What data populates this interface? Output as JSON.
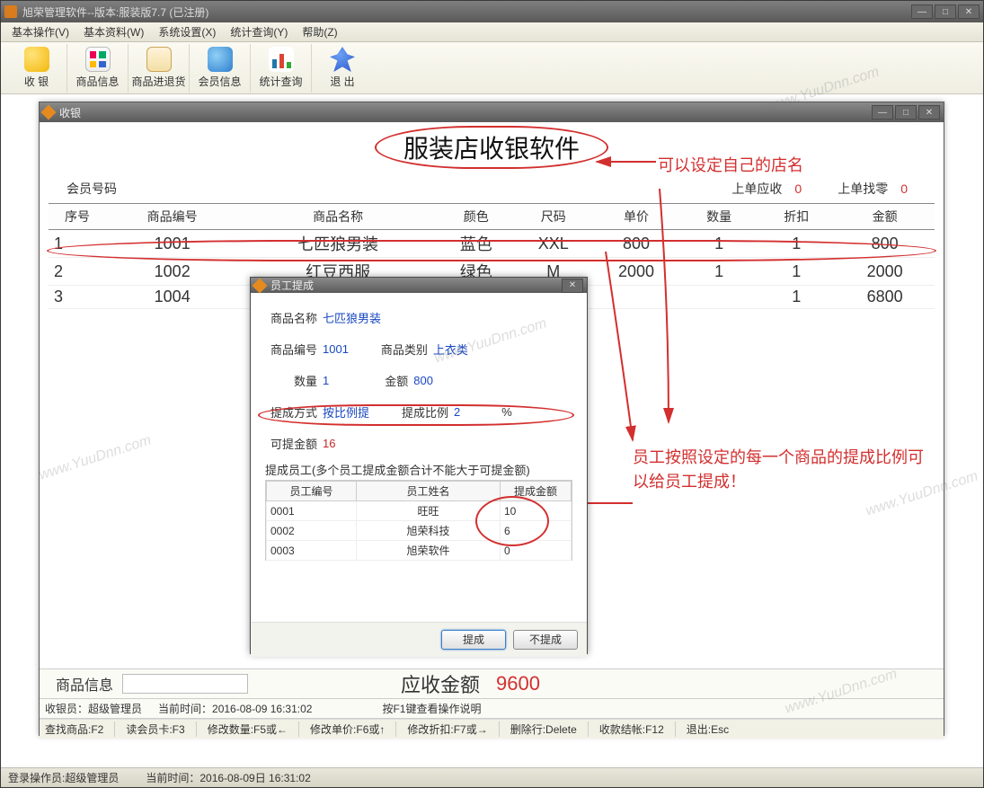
{
  "app": {
    "title": "旭荣管理软件--版本:服装版7.7  (已注册)"
  },
  "menubar": {
    "items": [
      "基本操作(V)",
      "基本资料(W)",
      "系统设置(X)",
      "统计查询(Y)",
      "帮助(Z)"
    ]
  },
  "toolbar": {
    "items": [
      {
        "label": "收 银",
        "color": "#f2b80c"
      },
      {
        "label": "商品信息",
        "color": "#8fc24a"
      },
      {
        "label": "商品进退货",
        "color": "#e9734a"
      },
      {
        "label": "会员信息",
        "color": "#3a87d6"
      },
      {
        "label": "统计查询",
        "color": "#d64e2a"
      },
      {
        "label": "退 出",
        "color": "#3a6fd6"
      }
    ]
  },
  "cashier": {
    "title": "收银",
    "store_title": "服装店收银软件",
    "member_label": "会员号码",
    "last_receivable_label": "上单应收",
    "last_receivable_value": "0",
    "last_change_label": "上单找零",
    "last_change_value": "0",
    "columns": [
      "序号",
      "商品编号",
      "商品名称",
      "颜色",
      "尺码",
      "单价",
      "数量",
      "折扣",
      "金额"
    ],
    "rows": [
      {
        "seq": "1",
        "code": "1001",
        "name": "七匹狼男装",
        "color": "蓝色",
        "size": "XXL",
        "price": "800",
        "qty": "1",
        "disc": "1",
        "amount": "800"
      },
      {
        "seq": "2",
        "code": "1002",
        "name": "红豆西服",
        "color": "绿色",
        "size": "M",
        "price": "2000",
        "qty": "1",
        "disc": "1",
        "amount": "2000"
      },
      {
        "seq": "3",
        "code": "1004",
        "name": "",
        "color": "",
        "size": "",
        "price": "",
        "qty": "",
        "disc": "1",
        "amount": "6800"
      }
    ],
    "product_info_label": "商品信息",
    "total_due_label": "应收金额",
    "total_due_value": "9600",
    "status1": {
      "cashier": "收银员：超级管理员",
      "now_label": "当前时间：",
      "now_value": "2016-08-09 16:31:02",
      "hint": "按F1键查看操作说明"
    },
    "status2": [
      "查找商品:F2",
      "读会员卡:F3",
      "修改数量:F5或←",
      "修改单价:F6或↑",
      "修改折扣:F7或→",
      "删除行:Delete",
      "收款结帐:F12",
      "退出:Esc"
    ]
  },
  "commission": {
    "title": "员工提成",
    "rows": {
      "product_name_label": "商品名称",
      "product_name_value": "七匹狼男装",
      "product_code_label": "商品编号",
      "product_code_value": "1001",
      "product_cat_label": "商品类别",
      "product_cat_value": "上衣类",
      "qty_label": "数量",
      "qty_value": "1",
      "amount_label": "金额",
      "amount_value": "800",
      "method_label": "提成方式",
      "method_value": "按比例提",
      "ratio_label": "提成比例",
      "ratio_value": "2",
      "ratio_unit": "%",
      "avail_label": "可提金额",
      "avail_value": "16"
    },
    "note": "提成员工(多个员工提成金额合计不能大于可提金额)",
    "emp_columns": [
      "员工编号",
      "员工姓名",
      "提成金额"
    ],
    "employees": [
      {
        "id": "0001",
        "name": "旺旺",
        "amt": "10"
      },
      {
        "id": "0002",
        "name": "旭荣科技",
        "amt": "6"
      },
      {
        "id": "0003",
        "name": "旭荣软件",
        "amt": "0"
      }
    ],
    "btn_ok": "提成",
    "btn_cancel": "不提成"
  },
  "annotations": {
    "store_hint": "可以设定自己的店名",
    "commission_hint": "员工按照设定的每一个商品的提成比例可以给员工提成！"
  },
  "outer_status": {
    "operator": "登录操作员:超级管理员",
    "now": "当前时间：2016-08-09日 16:31:02"
  },
  "watermark": "www.YuuDnn.com"
}
